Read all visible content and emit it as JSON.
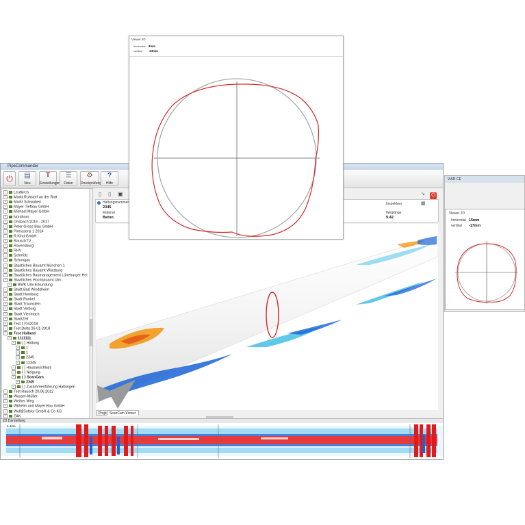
{
  "app": {
    "title": "PipeCommander",
    "toolbar": [
      {
        "label": "Neu",
        "icon": "new-document-icon"
      },
      {
        "label": "Einstellungen",
        "icon": "settings-icon"
      },
      {
        "label": "Daten",
        "icon": "data-icon"
      },
      {
        "label": "Druckprüfung",
        "icon": "pressure-test-icon"
      },
      {
        "label": "Hilfe",
        "icon": "help-icon"
      }
    ]
  },
  "tree": {
    "items": [
      {
        "label": "Leutkirch",
        "level": 0
      },
      {
        "label": "Markt Ruhstorf an der Rott",
        "level": 0
      },
      {
        "label": "Markt Schwaben",
        "level": 0
      },
      {
        "label": "Mayer Tiefbau GmbH",
        "level": 0
      },
      {
        "label": "Michael Mayer GmbH",
        "level": 0
      },
      {
        "label": "Nordhorn",
        "level": 0
      },
      {
        "label": "Onsbach 2016 - 2017",
        "level": 0
      },
      {
        "label": "Peter Gross Bau GmbH",
        "level": 0
      },
      {
        "label": "Pirmasens 1 2014",
        "level": 0
      },
      {
        "label": "R.Kind GmbH",
        "level": 0
      },
      {
        "label": "RauschTV",
        "level": 0
      },
      {
        "label": "Ravensburg",
        "level": 0
      },
      {
        "label": "RHV",
        "level": 0
      },
      {
        "label": "Schmölz",
        "level": 0
      },
      {
        "label": "Schongau",
        "level": 0
      },
      {
        "label": "Staatliches Bauamt München 1",
        "level": 0
      },
      {
        "label": "Staatliches Bauamt Würzburg",
        "level": 0
      },
      {
        "label": "Staatliches Baumanagement Lüneburger Hei",
        "level": 0
      },
      {
        "label": "Staatliches Hochbauamt Ulm",
        "level": 0
      },
      {
        "label": "BWK Ulm Erkundung",
        "level": 1
      },
      {
        "label": "Stadt Bad Windsheim",
        "level": 0
      },
      {
        "label": "Stadt Homburg",
        "level": 0
      },
      {
        "label": "Stadt Runkel",
        "level": 0
      },
      {
        "label": "Stadt Traunstein",
        "level": 0
      },
      {
        "label": "Stadt Velburg",
        "level": 0
      },
      {
        "label": "Stadt Viechtach",
        "level": 0
      },
      {
        "label": "StadtZell",
        "level": 0
      },
      {
        "label": "Test 17042018",
        "level": 0
      },
      {
        "label": "Test Delta 26-01-2018",
        "level": 0
      },
      {
        "label": "Test Holland",
        "level": 0,
        "bold": true
      },
      {
        "label": "1111111",
        "level": 1,
        "bold": true
      },
      {
        "label": "{ } Haltung",
        "level": 2
      },
      {
        "label": "1",
        "level": 3
      },
      {
        "label": "1",
        "level": 3
      },
      {
        "label": "2345",
        "level": 3
      },
      {
        "label": "12345",
        "level": 3
      },
      {
        "label": "{ } Hausanschluss",
        "level": 2
      },
      {
        "label": "{ } Neigung",
        "level": 2
      },
      {
        "label": "{ } ScanCam",
        "level": 2,
        "bold": true
      },
      {
        "label": "2345",
        "level": 3,
        "bold": true
      },
      {
        "label": "{ } Zusammenführung Haltungen",
        "level": 2
      },
      {
        "label": "Test Rausch 20.06.2012",
        "level": 0
      },
      {
        "label": "Wasser-Müller",
        "level": 0
      },
      {
        "label": "Weiher Weg",
        "level": 0
      },
      {
        "label": "Wilhelm und Mayer Bau GmbH",
        "level": 0
      },
      {
        "label": "Wolf&Sofsky GmbH & Co KG",
        "level": 0
      },
      {
        "label": "ZAK",
        "level": 0
      },
      {
        "label": "Zimmermann & Meisner",
        "level": 0
      },
      {
        "label": "Zusmarshausen_Steinebergring 1",
        "level": 0
      }
    ]
  },
  "info": {
    "haltungsnummer_label": "Haltungsnummer",
    "haltungsnummer_value": "2345",
    "material_label": "Material",
    "material_value": "Beton",
    "inspekteur_label": "Inspekteur",
    "inspekteur_value": "",
    "weglaenge_label": "Weglänge",
    "weglaenge_value": "9.42"
  },
  "tabs": [
    "Projekt",
    "ScanCam Viewer"
  ],
  "panel2d": {
    "title": "2D Darstellung",
    "scale_label": "4.42m"
  },
  "side_panel": {
    "title": "ViAR-CE",
    "viewer_title": "Viewer 2D",
    "horizontal_label": "horizontal",
    "horizontal_value": "15mm",
    "vertical_label": "vertikal",
    "vertical_value": "-17mm"
  },
  "viewer_big": {
    "title": "Viewer 2D",
    "horizontal_label": "horizontal",
    "horizontal_value": "9mm",
    "vertical_label": "vertikal",
    "vertical_value": "-23mm"
  },
  "colors": {
    "deformation_line": "#d42525",
    "reference_circle": "#a8a8a8",
    "heat_red": "#e21a1a",
    "heat_blue": "#1a63d6",
    "heat_cyan": "#4fc3e8"
  }
}
